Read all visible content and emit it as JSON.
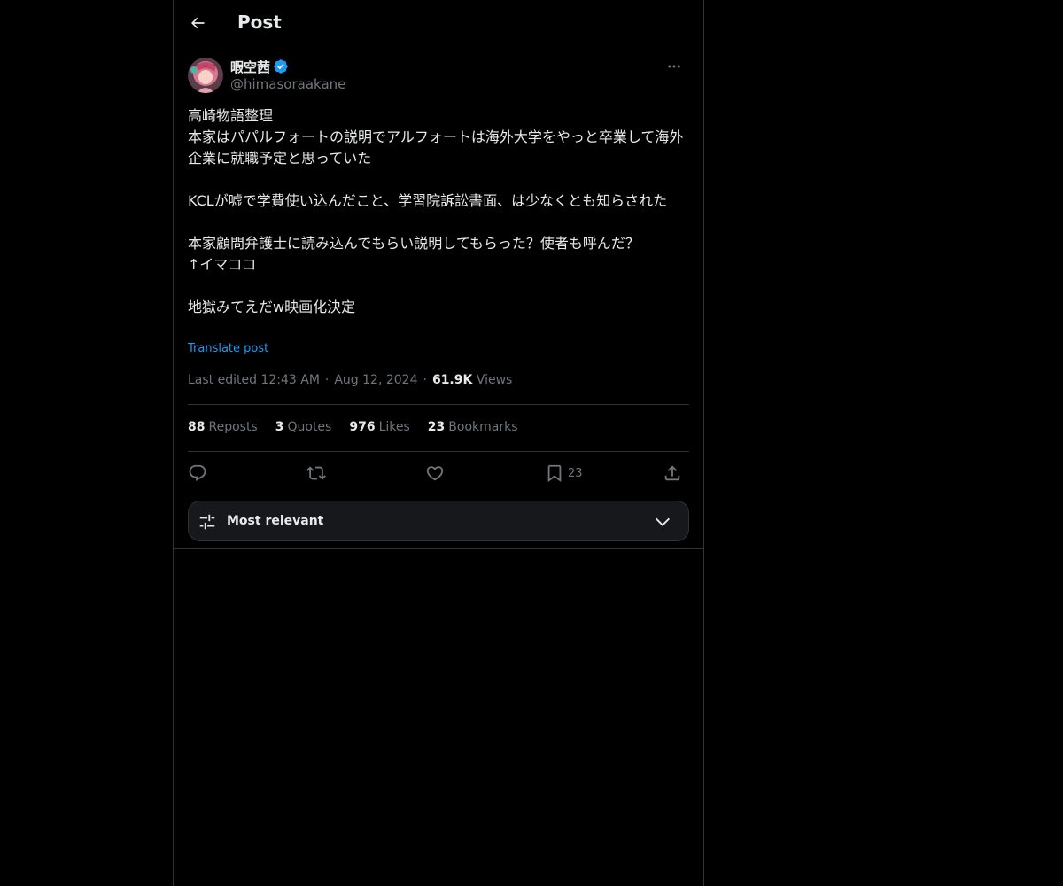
{
  "header": {
    "title": "Post",
    "back_icon": "back-arrow-icon"
  },
  "author": {
    "display_name": "暇空茜",
    "handle": "@himasoraakane",
    "verified_icon": "verified-badge-icon",
    "verified_color": "#1d9bf0"
  },
  "post": {
    "text": "高崎物語整理\n本家はパパルフォートの説明でアルフォートは海外大学をやっと卒業して海外企業に就職予定と思っていた\n\nKCLが嘘で学費使い込んだこと、学習院訴訟書面、は少なくとも知らされた\n\n本家顧問弁護士に読み込んでもらい説明してもらった？使者も呼んだ？\n↑イマココ\n\n地獄みてえだw映画化決定",
    "translate_label": "Translate post",
    "edited_label": "Last edited 12:43 AM",
    "date": "Aug 12, 2024",
    "views_count": "61.9K",
    "views_label": "Views"
  },
  "stats": {
    "reposts": {
      "count": "88",
      "label": "Reposts"
    },
    "quotes": {
      "count": "3",
      "label": "Quotes"
    },
    "likes": {
      "count": "976",
      "label": "Likes"
    },
    "bookmarks": {
      "count": "23",
      "label": "Bookmarks"
    }
  },
  "actions": {
    "reply_icon": "reply-icon",
    "repost_icon": "repost-icon",
    "like_icon": "heart-icon",
    "bookmark_icon": "bookmark-icon",
    "bookmark_count": "23",
    "share_icon": "share-icon"
  },
  "replies_sort": {
    "label": "Most relevant",
    "icon": "sliders-icon",
    "chevron": "chevron-down-icon"
  },
  "colors": {
    "background": "#000000",
    "text": "#e7e9ea",
    "muted": "#71767b",
    "accent": "#1d9bf0",
    "border": "#2f3336"
  }
}
